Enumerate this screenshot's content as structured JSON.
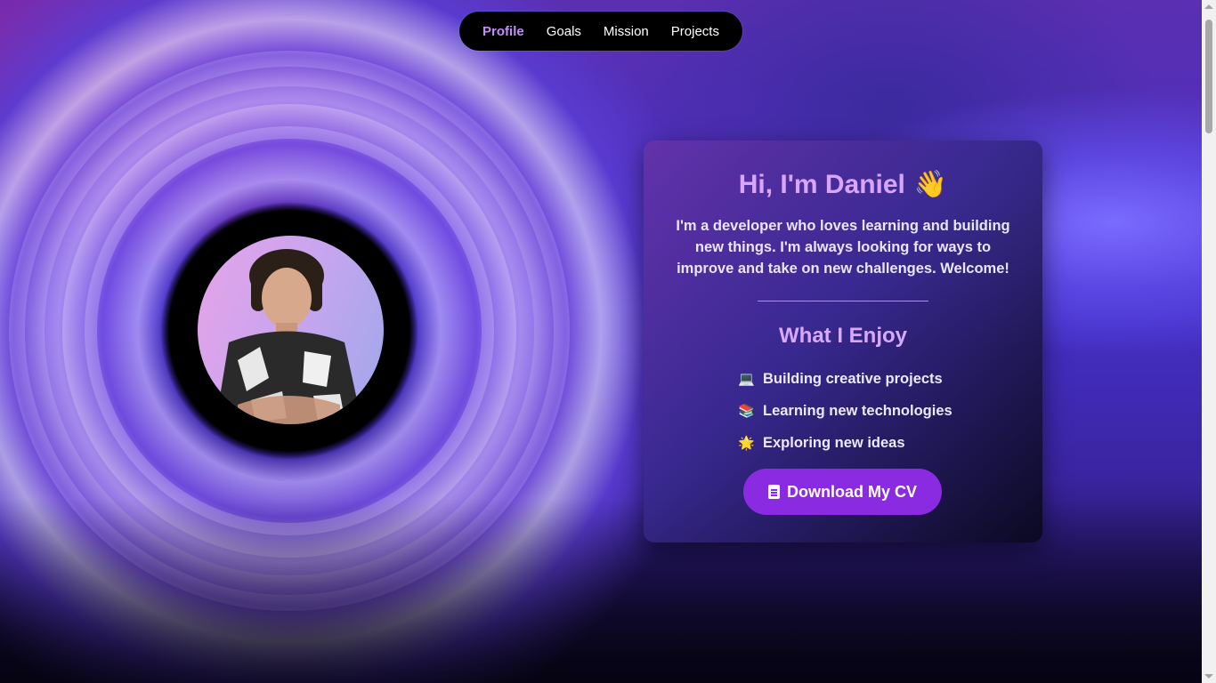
{
  "nav": {
    "items": [
      {
        "label": "Profile",
        "active": true
      },
      {
        "label": "Goals",
        "active": false
      },
      {
        "label": "Mission",
        "active": false
      },
      {
        "label": "Projects",
        "active": false
      }
    ]
  },
  "hero": {
    "photo_alt": "profile-photo"
  },
  "card": {
    "greeting": "Hi, I'm Daniel",
    "greeting_icon": "👋",
    "intro": "I'm a developer who loves learning and building new things. I'm always looking for ways to improve and take on new challenges. Welcome!",
    "enjoy_title": "What I Enjoy",
    "enjoy_items": [
      {
        "icon": "💻",
        "icon_name": "laptop-icon",
        "label": "Building creative projects"
      },
      {
        "icon": "📚",
        "icon_name": "books-icon",
        "label": "Learning new technologies"
      },
      {
        "icon": "🌟",
        "icon_name": "star-icon",
        "label": "Exploring new ideas"
      }
    ],
    "cv_button_label": "Download My CV"
  },
  "colors": {
    "accent": "#8a2be2",
    "active_nav": "#c48aff",
    "heading": "#d9a6ff"
  }
}
